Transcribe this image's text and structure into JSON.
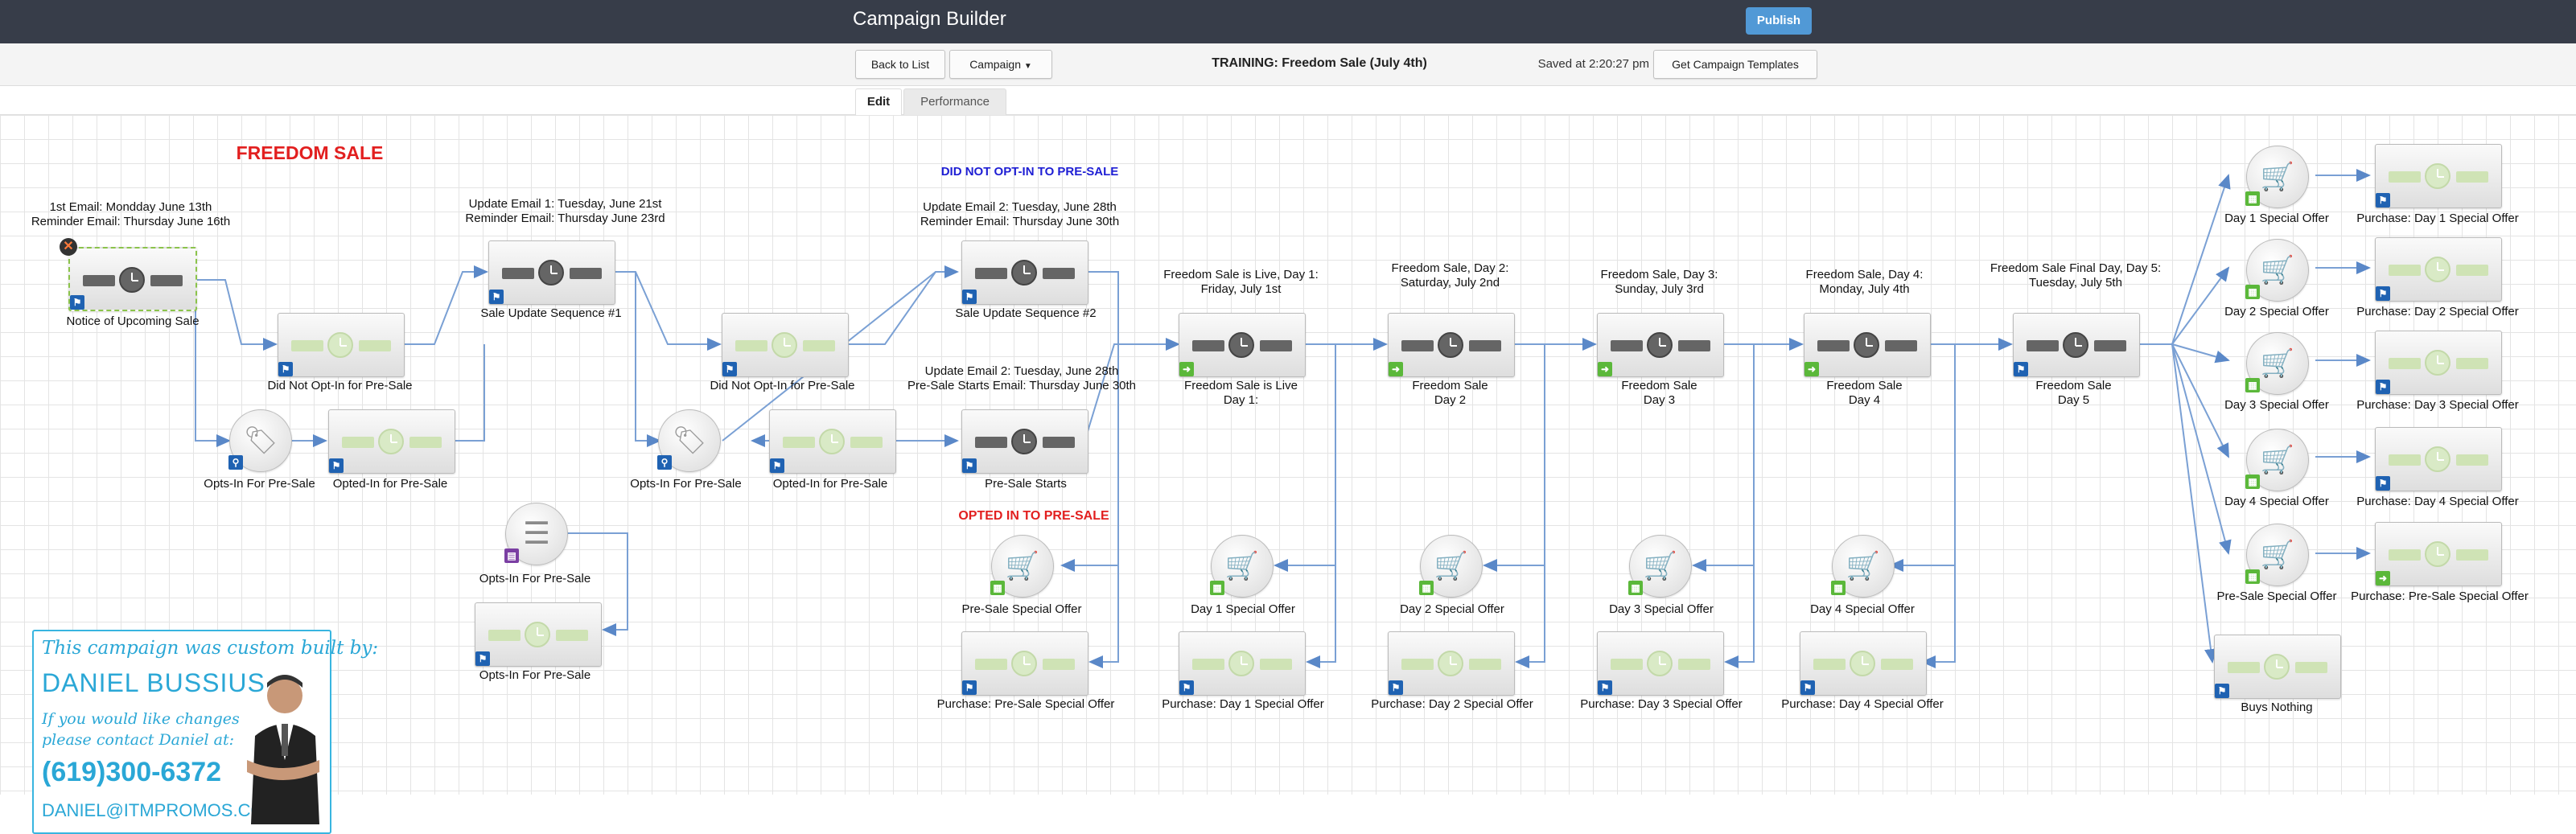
{
  "header": {
    "title": "Campaign Builder",
    "publish": "Publish"
  },
  "toolbar": {
    "back": "Back to List",
    "campaign": "Campaign",
    "campaign_name": "TRAINING: Freedom Sale (July 4th)",
    "saved": "Saved at 2:20:27 pm",
    "templates": "Get Campaign Templates"
  },
  "tabs": {
    "edit": "Edit",
    "performance": "Performance"
  },
  "colors": {
    "red_heading": "#e21f1f",
    "blue_heading": "#1e1ed4",
    "accent": "#5199d6"
  },
  "canvas": {
    "title": "FREEDOM SALE",
    "did_not_optin": "DID NOT OPT-IN TO PRE-SALE",
    "opted_in": "OPTED IN TO PRE-SALE",
    "notes": {
      "n1a": "1st Email: Mondday June 13th",
      "n1b": "Reminder Email: Thursday June 16th",
      "n2a": "Update Email 1: Tuesday, June 21st",
      "n2b": "Reminder Email: Thursday June 23rd",
      "n3a": "Update Email 2: Tuesday, June 28th",
      "n3b": "Reminder Email: Thursday June 30th",
      "n4a": "Update Email 2: Tuesday, June 28th",
      "n4b": "Pre-Sale Starts Email: Thursday June 30th",
      "d1a": "Freedom Sale is Live, Day 1:",
      "d1b": "Friday, July 1st",
      "d2a": "Freedom Sale, Day 2:",
      "d2b": "Saturday, July 2nd",
      "d3a": "Freedom Sale, Day 3:",
      "d3b": "Sunday, July 3rd",
      "d4a": "Freedom Sale, Day 4:",
      "d4b": "Monday, July 4th",
      "d5a": "Freedom Sale Final Day, Day 5:",
      "d5b": "Tuesday, July 5th"
    },
    "labels": {
      "notice": "Notice of Upcoming Sale",
      "did_not_1": "Did Not Opt-In for Pre-Sale",
      "opts_in_1": "Opts-In For Pre-Sale",
      "opted_in_1": "Opted-In for Pre-Sale",
      "sale_update_1": "Sale Update Sequence #1",
      "did_not_2": "Did Not Opt-In for Pre-Sale",
      "opts_in_2": "Opts-In For Pre-Sale",
      "opted_in_2": "Opted-In for Pre-Sale",
      "sale_update_2": "Sale Update Sequence #2",
      "presale_starts": "Pre-Sale Starts",
      "form_opts": "Opts-In For Pre-Sale",
      "seq_opts": "Opts-In For Pre-Sale",
      "live_a": "Freedom Sale is Live",
      "live_b": "Day 1:",
      "fs2a": "Freedom Sale",
      "fs2b": "Day 2",
      "fs3a": "Freedom Sale",
      "fs3b": "Day 3",
      "fs4a": "Freedom Sale",
      "fs4b": "Day 4",
      "fs5a": "Freedom Sale",
      "fs5b": "Day 5",
      "presale_offer": "Pre-Sale Special Offer",
      "day1_offer": "Day 1 Special Offer",
      "day2_offer": "Day 2 Special Offer",
      "day3_offer": "Day 3 Special Offer",
      "day4_offer": "Day 4 Special Offer",
      "p_presale": "Purchase: Pre-Sale Special Offer",
      "p_day1": "Purchase: Day 1 Special Offer",
      "p_day2": "Purchase: Day 2 Special Offer",
      "p_day3": "Purchase: Day 3 Special Offer",
      "p_day4": "Purchase: Day 4 Special Offer",
      "r_day1": "Day 1 Special Offer",
      "r_p1": "Purchase: Day 1 Special Offer",
      "r_day2": "Day 2 Special Offer",
      "r_p2": "Purchase: Day 2 Special Offer",
      "r_day3": "Day 3 Special Offer",
      "r_p3": "Purchase: Day 3 Special Offer",
      "r_day4": "Day 4 Special Offer",
      "r_p4": "Purchase: Day 4 Special Offer",
      "r_pre": "Pre-Sale Special Offer",
      "r_ppre": "Purchase: Pre-Sale Special Offer",
      "buys_nothing": "Buys Nothing"
    },
    "promo": {
      "line1": "This campaign was custom built by:",
      "line2": "DANIEL BUSSIUS",
      "line3": "If you would like changes please contact Daniel at:",
      "phone": "(619)300-6372",
      "email": "DANIEL@ITMPROMOS.COM"
    }
  }
}
